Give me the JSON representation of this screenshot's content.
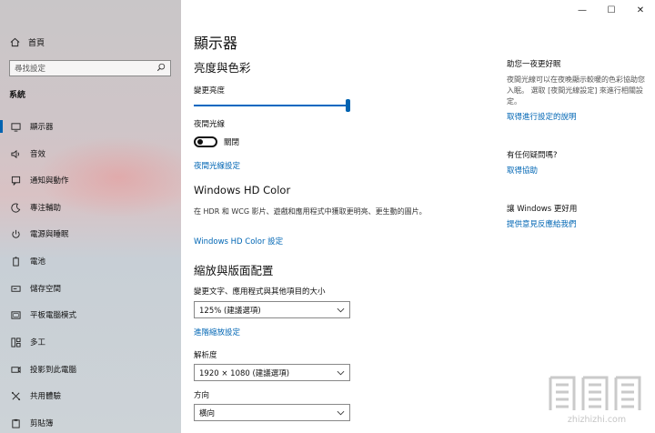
{
  "sidebar": {
    "home_label": "首頁",
    "search_placeholder": "尋找設定",
    "group_label": "系統",
    "items": [
      {
        "label": "顯示器",
        "icon": "monitor-icon",
        "active": true
      },
      {
        "label": "音效",
        "icon": "speaker-icon"
      },
      {
        "label": "通知與動作",
        "icon": "notification-icon"
      },
      {
        "label": "專注輔助",
        "icon": "moon-icon"
      },
      {
        "label": "電源與睡眠",
        "icon": "power-icon"
      },
      {
        "label": "電池",
        "icon": "battery-icon"
      },
      {
        "label": "儲存空間",
        "icon": "storage-icon"
      },
      {
        "label": "平板電腦模式",
        "icon": "tablet-icon"
      },
      {
        "label": "多工",
        "icon": "multitask-icon"
      },
      {
        "label": "投影到此電腦",
        "icon": "project-icon"
      },
      {
        "label": "共用體驗",
        "icon": "shared-icon"
      },
      {
        "label": "剪貼簿",
        "icon": "clipboard-icon"
      }
    ]
  },
  "window": {
    "minimize": "—",
    "maximize": "☐",
    "close": "✕"
  },
  "main": {
    "page_title": "顯示器",
    "brightness_section": "亮度與色彩",
    "brightness_label": "變更亮度",
    "brightness_value": 1.0,
    "night_light_label": "夜間光線",
    "night_light_state": "關閉",
    "night_light_link": "夜間光線設定",
    "hdr_section": "Windows HD Color",
    "hdr_description": "在 HDR 和 WCG 影片、遊戲和應用程式中獲取更明亮、更生動的圖片。",
    "hdr_link": "Windows HD Color 設定",
    "scale_section": "縮放與版面配置",
    "scale_label": "變更文字、應用程式與其他項目的大小",
    "scale_value": "125% (建議選項)",
    "advanced_scale_link": "進階縮放設定",
    "resolution_label": "解析度",
    "resolution_value": "1920 × 1080 (建議選項)",
    "orientation_label": "方向",
    "orientation_value": "橫向"
  },
  "right_panel": {
    "night_title": "助您一夜更好眠",
    "night_text": "夜間光線可以在夜晚顯示較暖的色彩協助您入眠。 選取 [夜間光線設定] 來進行相關設定。",
    "night_link": "取得進行設定的說明",
    "question_title": "有任何疑問嗎?",
    "question_link": "取得協助",
    "improve_title": "讓 Windows 更好用",
    "improve_link": "提供意見反應給我們"
  },
  "watermark": {
    "text": "zhizhizhi.com"
  },
  "colors": {
    "accent": "#0063b1",
    "link": "#0066b4"
  }
}
